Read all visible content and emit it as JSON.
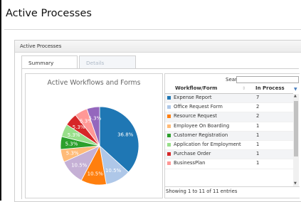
{
  "page": {
    "title": "Active Processes"
  },
  "panel": {
    "header": "Active Processes"
  },
  "tabs": [
    {
      "label": "Summary"
    },
    {
      "label": "Details"
    }
  ],
  "chart_data": {
    "type": "pie",
    "title": "Active Workflows and Forms",
    "slices": [
      {
        "label": "Expense Report",
        "value": 36.8,
        "display": "36.8%",
        "color": "#1f77b4"
      },
      {
        "label": "Office Request Form",
        "value": 10.5,
        "display": "10.5%",
        "color": "#aec7e8"
      },
      {
        "label": "Resource Request",
        "value": 10.5,
        "display": "10.5%",
        "color": "#ff7f0e"
      },
      {
        "label": "Employee On Boarding",
        "value": 10.5,
        "display": "10.5%",
        "color": "#c5b0d5"
      },
      {
        "label": "",
        "value": 5.3,
        "display": "5.3%",
        "color": "#ffbb78"
      },
      {
        "label": "Customer Registration",
        "value": 5.3,
        "display": "5.3%",
        "color": "#2ca02c"
      },
      {
        "label": "Application for Employment",
        "value": 5.3,
        "display": "5.3%",
        "color": "#98df8a"
      },
      {
        "label": "Purchase Order",
        "value": 5.3,
        "display": "5.3%",
        "color": "#d62728"
      },
      {
        "label": "BusinessPlan",
        "value": 5.3,
        "display": "5.3%",
        "color": "#ff9896"
      },
      {
        "label": "",
        "value": 5.3,
        "display": "5.3%",
        "color": "#9467bd"
      }
    ]
  },
  "table": {
    "search_label": "Search:",
    "search_value": "",
    "columns": {
      "workflow": "Workflow/Form",
      "in_process": "In Process"
    },
    "rows": [
      {
        "name": "Expense Report",
        "count": "7",
        "color": "#1f77b4"
      },
      {
        "name": "Office Request Form",
        "count": "2",
        "color": "#aec7e8"
      },
      {
        "name": "Resource Request",
        "count": "2",
        "color": "#ff7f0e"
      },
      {
        "name": "Employee On Boarding",
        "count": "1",
        "color": "#ffbb78"
      },
      {
        "name": "Customer Registration",
        "count": "1",
        "color": "#2ca02c"
      },
      {
        "name": "Application for Employment",
        "count": "1",
        "color": "#98df8a"
      },
      {
        "name": "Purchase Order",
        "count": "1",
        "color": "#d62728"
      },
      {
        "name": "BusinessPlan",
        "count": "1",
        "color": "#ff9896"
      }
    ],
    "info": "Showing 1 to 11 of 11 entries"
  }
}
